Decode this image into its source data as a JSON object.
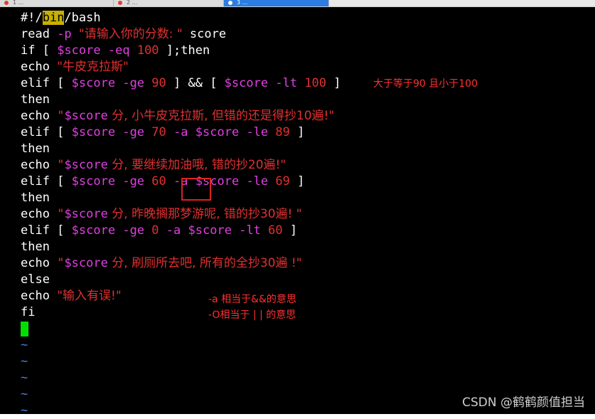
{
  "tabs": [
    {
      "label": "1 ... "
    },
    {
      "label": "2 ... "
    },
    {
      "label": "3 ... "
    }
  ],
  "code": {
    "l1": {
      "a": "#!/",
      "b": "bin",
      "c": "/bash"
    },
    "l2": {
      "a": "read ",
      "b": "-p ",
      "c": "\"请输入你的分数: \"",
      "d": " score"
    },
    "l3": {
      "a": "if [ ",
      "b": "$score",
      "c": " ",
      "d": "-eq",
      "e": " ",
      "f": "100",
      "g": " ];then"
    },
    "l4": {
      "a": "echo ",
      "b": "\"牛皮克拉斯\""
    },
    "l5": {
      "a": "elif [ ",
      "b": "$score",
      "c": " ",
      "d": "-ge",
      "e": " ",
      "f": "90",
      "g": " ] && [ ",
      "h": "$score",
      "i": " ",
      "j": "-lt",
      "k": " ",
      "l": "100",
      "m": " ]"
    },
    "l6": {
      "a": "then"
    },
    "l7": {
      "a": "echo ",
      "b": "\"",
      "c": "$score",
      "d": " 分, 小牛皮克拉斯, 但错的还是得抄10遍!\""
    },
    "l8": {
      "a": "elif [ ",
      "b": "$score",
      "c": " ",
      "d": "-ge",
      "e": " ",
      "f": "70",
      "g": " ",
      "h": "-a",
      "i": " ",
      "j": "$score",
      "k": " ",
      "l": "-le",
      "m": " ",
      "n": "89",
      "o": " ]"
    },
    "l9": {
      "a": "then"
    },
    "l10": {
      "a": "echo ",
      "b": "\"",
      "c": "$score",
      "d": " 分, 要继续加油哦, 错的抄20遍!\""
    },
    "l11": {
      "a": "elif [ ",
      "b": "$score",
      "c": " ",
      "d": "-ge",
      "e": " ",
      "f": "60",
      "g": " ",
      "h": "-a",
      "i": " ",
      "j": "$score",
      "k": " ",
      "l": "-le",
      "m": " ",
      "n": "69",
      "o": " ]"
    },
    "l12": {
      "a": "then"
    },
    "l13": {
      "a": "echo ",
      "b": "\"",
      "c": "$score",
      "d": " 分, 昨晚搁那梦游呢, 错的抄30遍! \""
    },
    "l14": {
      "a": "elif [ ",
      "b": "$score",
      "c": " ",
      "d": "-ge",
      "e": " ",
      "f": "0",
      "g": " ",
      "h": "-a",
      "i": " ",
      "j": "$score",
      "k": " ",
      "l": "-lt",
      "m": " ",
      "n": "60",
      "o": " ]"
    },
    "l15": {
      "a": "then"
    },
    "l16": {
      "a": "echo ",
      "b": "\"",
      "c": "$score",
      "d": " 分, 刷厕所去吧, 所有的全抄30遍 !\""
    },
    "l17": {
      "a": "else"
    },
    "l18": {
      "a": "echo ",
      "b": "\"输入有误!\""
    },
    "l19": {
      "a": "fi"
    },
    "tilde": "~"
  },
  "annotations": {
    "inline": "大于等于90 且小于100",
    "line1": "-a 相当于&&的意思",
    "line2": "-O相当于 | | 的意思"
  },
  "watermark": "CSDN @鹤鹤颜值担当",
  "colors": {
    "background": "#000000",
    "text": "#ffffff",
    "option": "#e040e0",
    "string": "#e03030",
    "tilde": "#4a7cd8",
    "cursor": "#00e000",
    "annotation": "#ff3030",
    "highlight": "#c8b000"
  }
}
